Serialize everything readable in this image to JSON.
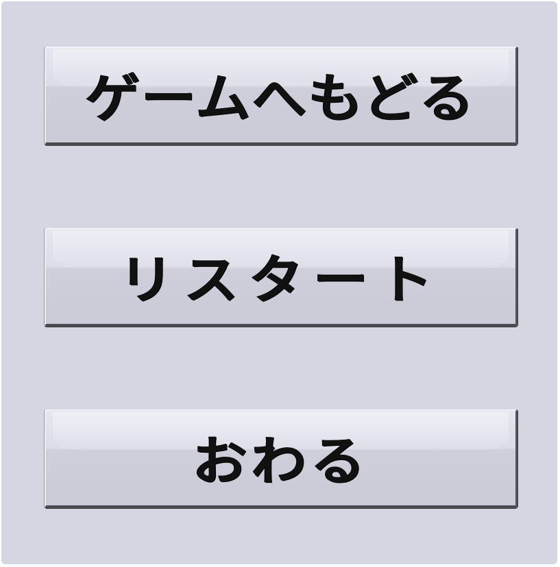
{
  "menu": {
    "buttons": [
      {
        "label": "ゲームへもどる"
      },
      {
        "label": "リスタート"
      },
      {
        "label": "おわる"
      }
    ]
  },
  "colors": {
    "background": "#d6d6e2",
    "button_face": "#d4d4e0",
    "button_shadow": "#4a4a52",
    "label": "#111111"
  }
}
